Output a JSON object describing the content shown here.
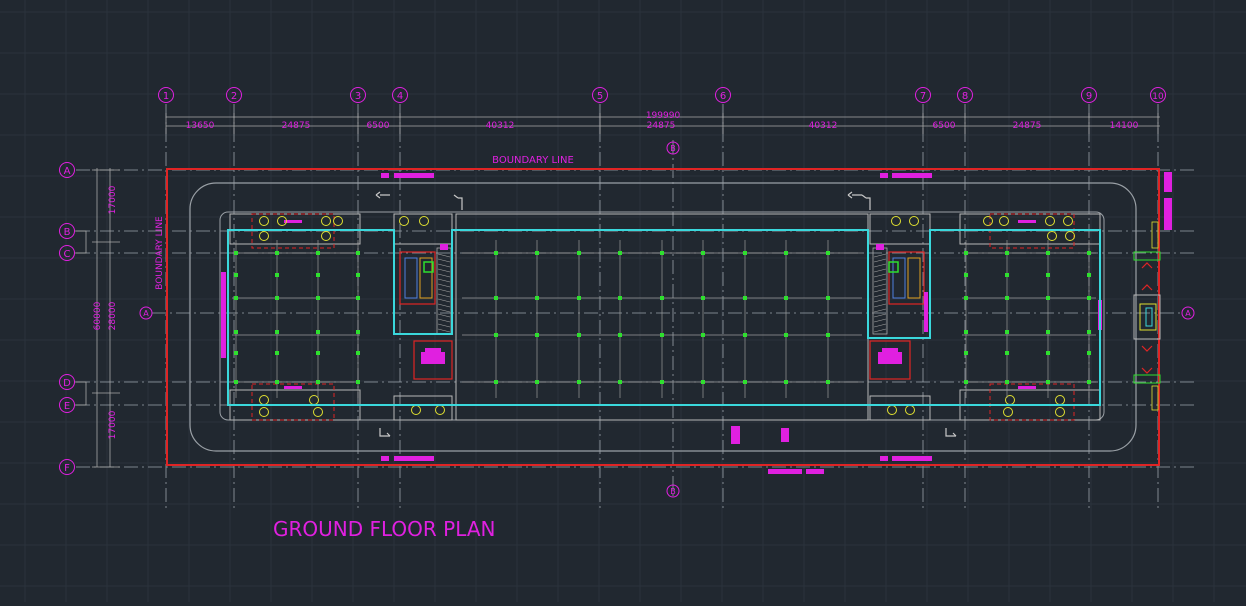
{
  "drawing": {
    "title": "GROUND FLOOR PLAN",
    "boundary_label_top": "BOUNDARY LINE",
    "boundary_label_left": "BOUNDARY LINE",
    "section_marks": {
      "a_left": "A",
      "a_right": "A",
      "b_top": "B",
      "b_bottom": "B"
    }
  },
  "grid_columns": [
    "1",
    "2",
    "3",
    "4",
    "5",
    "6",
    "7",
    "8",
    "9",
    "10"
  ],
  "grid_rows": [
    "A",
    "B",
    "C",
    "D",
    "E",
    "F"
  ],
  "dimensions": {
    "overall_top": "199990",
    "top": [
      "13650",
      "24875",
      "6500",
      "40312",
      "24875",
      "40312",
      "6500",
      "24875",
      "14100"
    ],
    "left_vertical": [
      "17000",
      "28000",
      "60000",
      "17000"
    ]
  },
  "colors": {
    "background": "#212830",
    "grid_line": "#2c3540",
    "annotation": "#e020e0",
    "boundary": "#e02424",
    "slab": "#3ad8dc",
    "columns": "#2ee02e",
    "walls": "#b8b8b8",
    "fixtures": "#e0e030"
  }
}
